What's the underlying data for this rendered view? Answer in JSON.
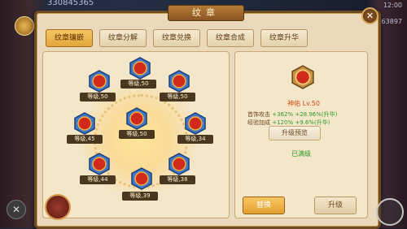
{
  "top_left_number": "330845365",
  "time": "12:00",
  "top_right_number": "63897",
  "title": "纹章",
  "tabs": [
    "纹章镶嵌",
    "纹章分解",
    "纹章兑换",
    "纹章合成",
    "纹章升华"
  ],
  "emblems": [
    {
      "name": "emblem-1",
      "level": "等级,50"
    },
    {
      "name": "emblem-2",
      "level": "等级,50"
    },
    {
      "name": "emblem-3",
      "level": "等级,50"
    },
    {
      "name": "emblem-4",
      "level": "等级,45"
    },
    {
      "name": "emblem-5",
      "level": "等级,50"
    },
    {
      "name": "emblem-6",
      "level": "等级,34"
    },
    {
      "name": "emblem-7",
      "level": "等级,44"
    },
    {
      "name": "emblem-8",
      "level": "等级,39"
    },
    {
      "name": "emblem-9",
      "level": "等级,38"
    }
  ],
  "detail": {
    "name": "神佑 Lv.50",
    "stat1_label": "首饰攻击",
    "stat1_value": "+362%",
    "stat1_extra": "+28.96%(升华)",
    "stat2_label": "经验加成",
    "stat2_value": "+120%",
    "stat2_extra": "+9.6%(升华)",
    "preview_button": "升级预览",
    "status": "已满级"
  },
  "buttons": {
    "replace": "替换",
    "upgrade": "升级"
  },
  "colors": {
    "panel": "#ead9ba",
    "accent": "#e3a63a",
    "green": "#2f9a2a",
    "badge_blue": "#3f77c9"
  }
}
